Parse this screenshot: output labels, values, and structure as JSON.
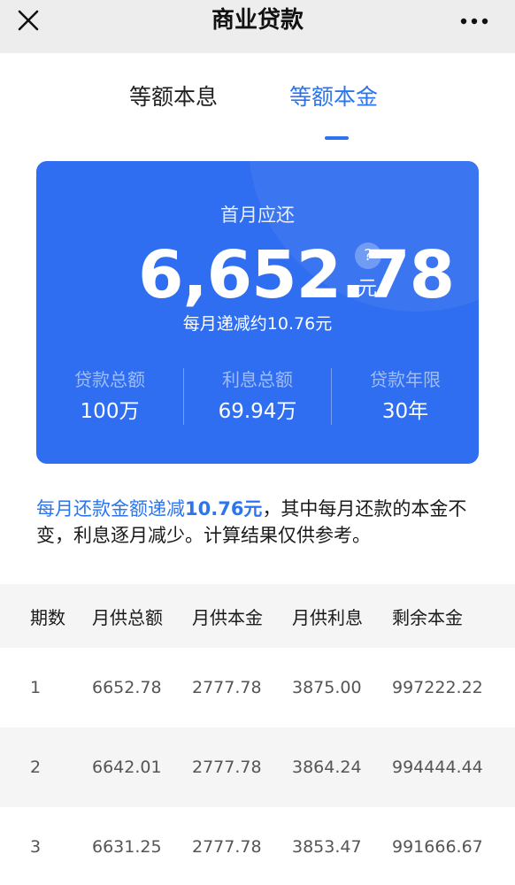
{
  "nav": {
    "title": "商业贷款",
    "close_icon": "close-icon",
    "more_icon": "more-dots-icon"
  },
  "tabs": [
    {
      "label": "等额本息",
      "active": false
    },
    {
      "label": "等额本金",
      "active": true
    }
  ],
  "summary": {
    "label": "首月应还",
    "amount": "6,652.78",
    "unit": "元",
    "help": "?",
    "decrease_text": "每月递减约10.76元",
    "stats": [
      {
        "label": "贷款总额",
        "value": "100万"
      },
      {
        "label": "利息总额",
        "value": "69.94万"
      },
      {
        "label": "贷款年限",
        "value": "30年"
      }
    ]
  },
  "note": {
    "highlight_prefix": "每月还款金额递减",
    "highlight_value": "10.76元",
    "rest": "，其中每月还款的本金不变，利息逐月减少。计算结果仅供参考。"
  },
  "table": {
    "headers": [
      "期数",
      "月供总额",
      "月供本金",
      "月供利息",
      "剩余本金"
    ],
    "rows": [
      [
        "1",
        "6652.78",
        "2777.78",
        "3875.00",
        "997222.22"
      ],
      [
        "2",
        "6642.01",
        "2777.78",
        "3864.24",
        "994444.44"
      ],
      [
        "3",
        "6631.25",
        "2777.78",
        "3853.47",
        "991666.67"
      ]
    ]
  },
  "colors": {
    "accent": "#2b75f0",
    "card": "#2f6ef0",
    "nav_bg": "#ededed",
    "stripe": "#f5f5f5"
  }
}
